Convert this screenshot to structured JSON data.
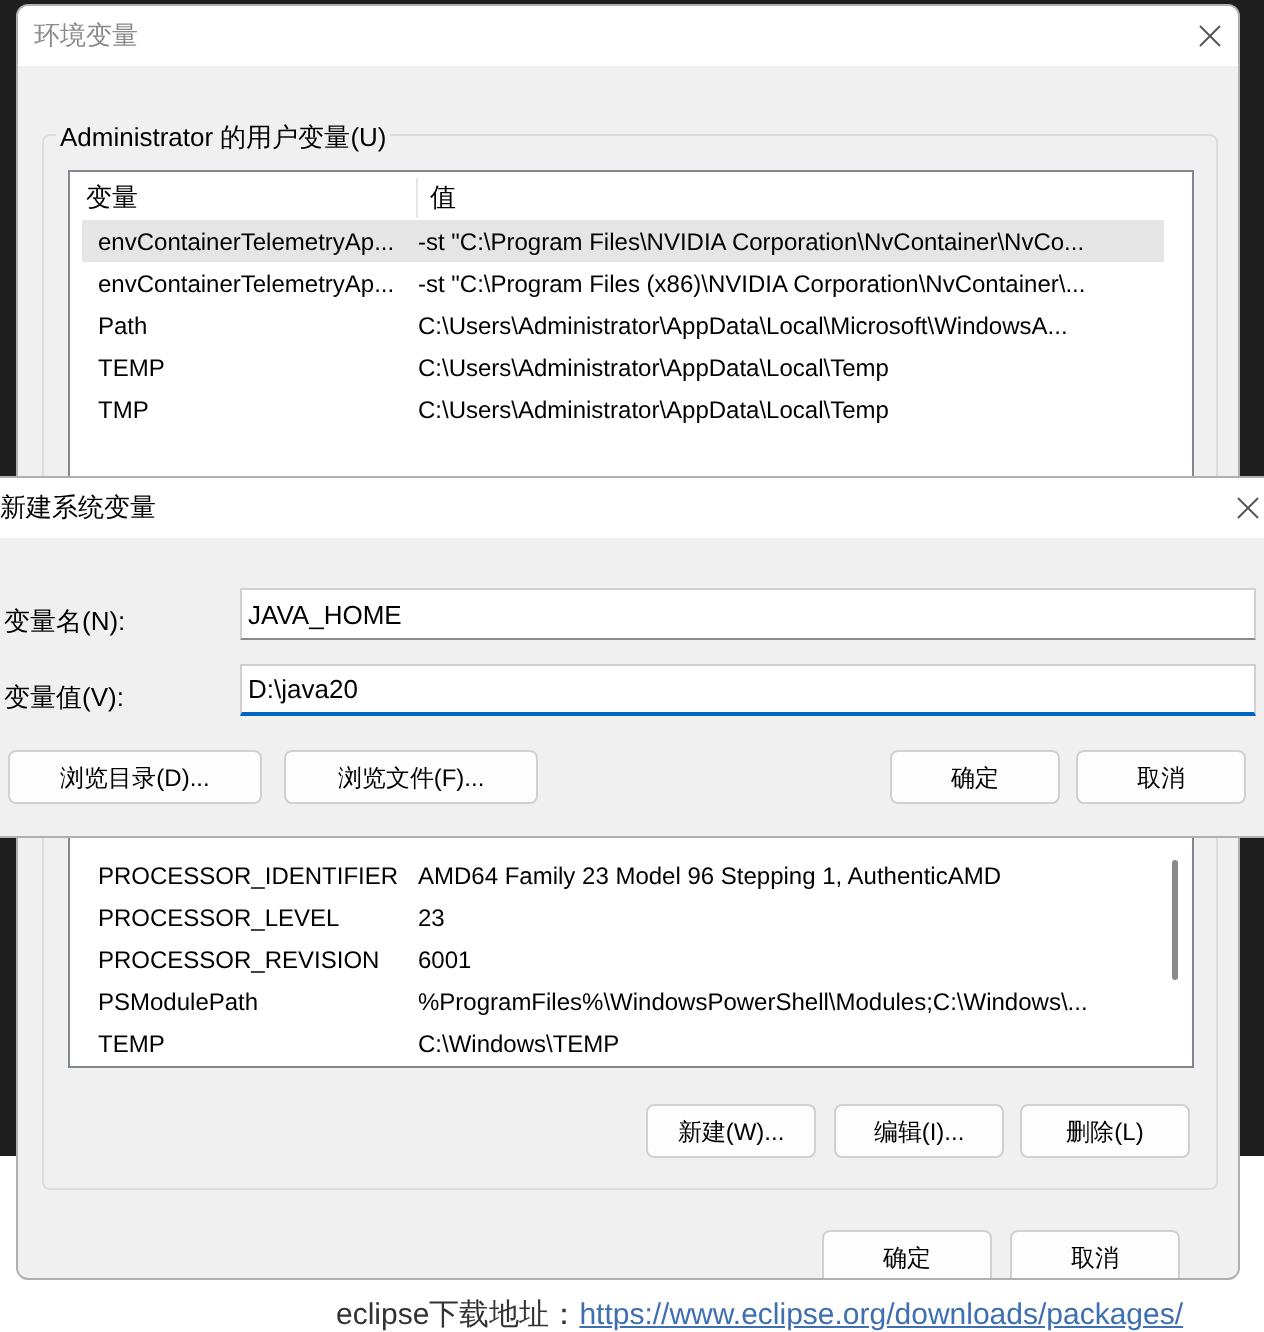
{
  "env_window": {
    "title": "环境变量",
    "active": false,
    "user_vars": {
      "label": "Administrator 的用户变量(U)",
      "columns": [
        "变量",
        "值"
      ],
      "rows": [
        {
          "name": "envContainerTelemetryAp...",
          "value": "-st \"C:\\Program Files\\NVIDIA Corporation\\NvContainer\\NvCo...",
          "selected": true
        },
        {
          "name": "envContainerTelemetryAp...",
          "value": "-st \"C:\\Program Files (x86)\\NVIDIA Corporation\\NvContainer\\...",
          "selected": false
        },
        {
          "name": "Path",
          "value": "C:\\Users\\Administrator\\AppData\\Local\\Microsoft\\WindowsA...",
          "selected": false
        },
        {
          "name": "TEMP",
          "value": "C:\\Users\\Administrator\\AppData\\Local\\Temp",
          "selected": false
        },
        {
          "name": "TMP",
          "value": "C:\\Users\\Administrator\\AppData\\Local\\Temp",
          "selected": false
        }
      ]
    },
    "system_vars": {
      "rows": [
        {
          "name": "PROCESSOR_IDENTIFIER",
          "value": "AMD64 Family 23 Model 96 Stepping 1, AuthenticAMD",
          "selected": false
        },
        {
          "name": "PROCESSOR_LEVEL",
          "value": "23",
          "selected": false
        },
        {
          "name": "PROCESSOR_REVISION",
          "value": "6001",
          "selected": false
        },
        {
          "name": "PSModulePath",
          "value": "%ProgramFiles%\\WindowsPowerShell\\Modules;C:\\Windows\\...",
          "selected": false
        },
        {
          "name": "TEMP",
          "value": "C:\\Windows\\TEMP",
          "selected": false
        }
      ],
      "buttons": [
        "新建(W)...",
        "编辑(I)...",
        "删除(L)"
      ]
    },
    "buttons": [
      "确定",
      "取消"
    ]
  },
  "new_var_dialog": {
    "title": "新建系统变量",
    "active": true,
    "fields": [
      {
        "label": "变量名(N):",
        "value": "JAVA_HOME",
        "focused": false
      },
      {
        "label": "变量值(V):",
        "value": "D:\\java20",
        "focused": true
      }
    ],
    "left_buttons": [
      "浏览目录(D)...",
      "浏览文件(F)..."
    ],
    "right_buttons": [
      "确定",
      "取消"
    ]
  },
  "page_text": {
    "text": "eclipse下载地址：",
    "link": "https://www.eclipse.org/downloads/packages/"
  }
}
